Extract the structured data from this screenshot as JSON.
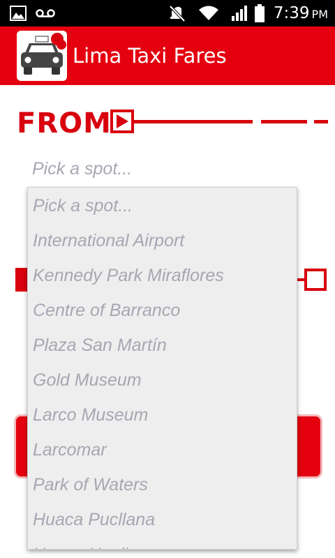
{
  "status_bar": {
    "time": "7:39",
    "ampm": "PM",
    "icons": [
      "image-icon",
      "voicemail-icon",
      "mute-icon",
      "wifi-icon",
      "signal-icon",
      "battery-icon"
    ]
  },
  "app_bar": {
    "title": "Lima Taxi Fares",
    "logo_icon": "taxi-logo-icon"
  },
  "form": {
    "from_label": "FROM",
    "from_placeholder": "Pick a spot..."
  },
  "dropdown": {
    "items": [
      "Pick a spot...",
      "International Airport",
      "Kennedy Park Miraflores",
      "Centre of Barranco",
      "Plaza San Martín",
      "Gold Museum",
      "Larco Museum",
      "Larcomar",
      "Park of Waters",
      "Huaca Pucllana",
      "Huaca Huallamarca"
    ]
  },
  "colors": {
    "accent": "#e5000f",
    "status_bar": "#000000",
    "hint_text": "#a7a7b3",
    "dropdown_bg": "#eeeeee"
  }
}
